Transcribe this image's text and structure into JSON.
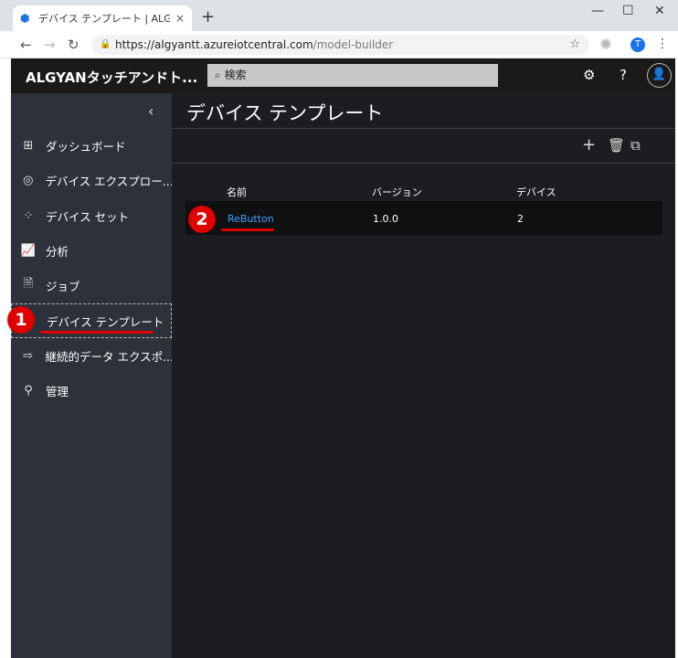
{
  "browser": {
    "tab_title": "デバイス テンプレート | ALGYANタッチ",
    "tab_close": "×",
    "new_tab": "+",
    "win_min": "—",
    "win_max": "☐",
    "win_close": "✕",
    "url_host": "https://algyantt.azureiotcentral.com",
    "url_path": "/model-builder",
    "profile_initial": "T"
  },
  "header": {
    "app_name": "ALGYANタッチアンドト...",
    "search_placeholder": "検索"
  },
  "sidebar": {
    "items": [
      {
        "label": "ダッシュボード",
        "icon": "dashboard-icon"
      },
      {
        "label": "デバイス エクスプロー...",
        "icon": "device-explorer-icon"
      },
      {
        "label": "デバイス セット",
        "icon": "device-set-icon"
      },
      {
        "label": "分析",
        "icon": "analytics-icon"
      },
      {
        "label": "ジョブ",
        "icon": "jobs-icon"
      },
      {
        "label": "デバイス テンプレート",
        "icon": "none"
      },
      {
        "label": "継続的データ エクスポ...",
        "icon": "export-icon"
      },
      {
        "label": "管理",
        "icon": "admin-icon"
      }
    ]
  },
  "main": {
    "title": "デバイス テンプレート",
    "columns": [
      "名前",
      "バージョン",
      "デバイス"
    ],
    "rows": [
      {
        "name": "ReButton",
        "version": "1.0.0",
        "devices": "2"
      }
    ]
  },
  "annotations": {
    "badge1": "1",
    "badge2": "2",
    "color": "#e00000"
  }
}
